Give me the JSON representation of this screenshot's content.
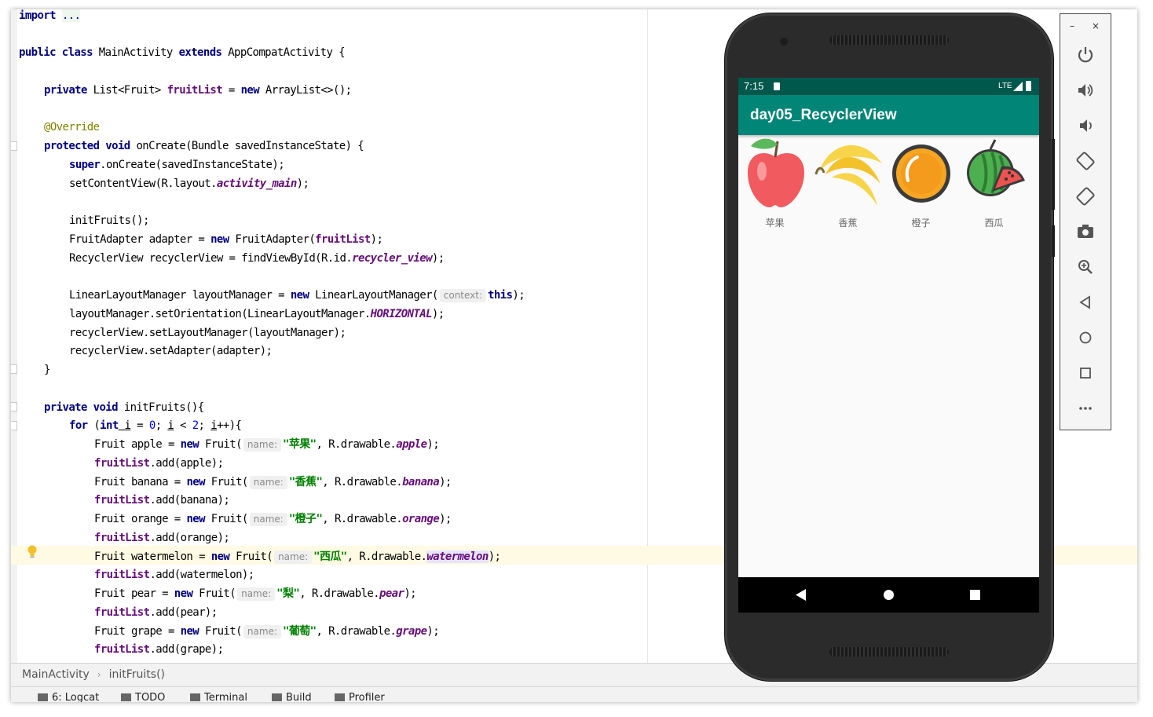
{
  "editor": {
    "lines": {
      "l0_import": "import",
      "l0_fold": "...",
      "l2_a": "public class",
      "l2_b": " MainActivity ",
      "l2_c": "extends",
      "l2_d": " AppCompatActivity {",
      "l4_a": "private",
      "l4_b": " List<Fruit> ",
      "l4_c": "fruitList",
      "l4_d": " = ",
      "l4_e": "new",
      "l4_f": " ArrayList<>();",
      "l6": "@Override",
      "l7_a": "protected void",
      "l7_b": " onCreate(Bundle savedInstanceState) {",
      "l8_a": "super",
      "l8_b": ".onCreate(savedInstanceState);",
      "l9_a": "setContentView(R.layout.",
      "l9_b": "activity_main",
      "l9_c": ");",
      "l11": "initFruits();",
      "l12_a": "FruitAdapter adapter = ",
      "l12_b": "new",
      "l12_c": " FruitAdapter(",
      "l12_d": "fruitList",
      "l12_e": ");",
      "l13_a": "RecyclerView recyclerView = findViewById(R.id.",
      "l13_b": "recycler_view",
      "l13_c": ");",
      "l15_a": "LinearLayoutManager layoutManager = ",
      "l15_b": "new",
      "l15_c": " LinearLayoutManager(",
      "l15_hint": "context:",
      "l15_d": "this",
      "l15_e": ");",
      "l16_a": "layoutManager.setOrientation(LinearLayoutManager.",
      "l16_b": "HORIZONTAL",
      "l16_c": ");",
      "l17": "recyclerView.setLayoutManager(layoutManager);",
      "l18": "recyclerView.setAdapter(adapter);",
      "l19": "}",
      "l21_a": "private void",
      "l21_b": " initFruits(){",
      "l22_a": "for",
      "l22_b": " (",
      "l22_c": "int",
      "l22_d": " i",
      "l22_e": " = ",
      "l22_f": "0",
      "l22_g": "; ",
      "l22_h": "i",
      "l22_i": " < ",
      "l22_j": "2",
      "l22_k": "; ",
      "l22_l": "i",
      "l22_m": "++){",
      "hint_name": "name:",
      "apple_a": "Fruit apple = ",
      "apple_s": "\"苹果\"",
      "apple_r": "apple",
      "banana_a": "Fruit banana = ",
      "banana_s": "\"香蕉\"",
      "banana_r": "banana",
      "orange_a": "Fruit orange = ",
      "orange_s": "\"橙子\"",
      "orange_r": "orange",
      "water_a": "Fruit watermelon = ",
      "water_s": "\"西瓜\"",
      "water_r": "watermelon",
      "pear_a": "Fruit pear = ",
      "pear_s": "\"梨\"",
      "pear_r": "pear",
      "grape_a": "Fruit grape = ",
      "grape_s": "\"葡萄\"",
      "grape_r": "grape",
      "new_kw": "new",
      "fruit_ctor": " Fruit(",
      "rdraw": ", R.drawable.",
      "close": ");",
      "fl": "fruitList",
      "add_apple": ".add(apple);",
      "add_banana": ".add(banana);",
      "add_orange": ".add(orange);",
      "add_water": ".add(watermelon);",
      "add_pear": ".add(pear);",
      "add_grape": ".add(grape);"
    }
  },
  "breadcrumb": [
    "MainActivity",
    "initFruits()"
  ],
  "toolwindows": [
    "6: Logcat",
    "TODO",
    "Terminal",
    "Build",
    "Profiler"
  ],
  "emulator": {
    "status_time": "7:15",
    "status_network": "LTE",
    "app_title": "day05_RecyclerView",
    "fruits": [
      "苹果",
      "香蕉",
      "橙子",
      "西瓜"
    ],
    "colors": {
      "status": "#00574b",
      "appbar": "#008577"
    }
  },
  "emulator_panel": {
    "window_minimize": "–",
    "window_close": "×",
    "buttons": [
      "power-icon",
      "volume-up-icon",
      "volume-down-icon",
      "rotate-left-icon",
      "rotate-right-icon",
      "camera-icon",
      "zoom-icon",
      "back-icon",
      "home-icon",
      "overview-icon",
      "more-icon"
    ]
  }
}
